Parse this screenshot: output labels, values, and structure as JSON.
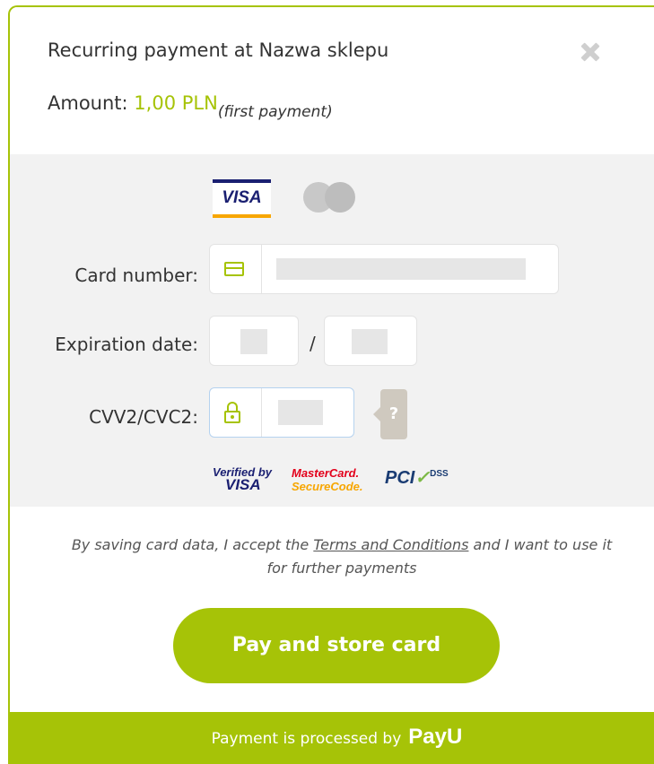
{
  "header": {
    "title": "Recurring payment at Nazwa sklepu",
    "amount_label": "Amount:",
    "amount_value": "1,00 PLN",
    "amount_note": "(first payment)"
  },
  "card_brands": {
    "visa": "VISA"
  },
  "form": {
    "card_number_label": "Card number:",
    "expiration_label": "Expiration date:",
    "expiration_separator": "/",
    "cvv_label": "CVV2/CVC2:",
    "help_label": "?"
  },
  "security_logos": {
    "verified_line1": "Verified by",
    "verified_line2": "VISA",
    "mc_line1": "MasterCard.",
    "mc_line2": "SecureCode.",
    "pci": "PCI",
    "dss": "DSS"
  },
  "consent": {
    "before": "By saving card data, I accept the ",
    "terms": "Terms and Conditions",
    "after": " and I want to use it for further payments"
  },
  "pay_button": "Pay and store card",
  "footer": {
    "text": "Payment is processed by",
    "brand": "PayU"
  },
  "colors": {
    "accent": "#a6c307",
    "panel": "#f2f2f2"
  }
}
